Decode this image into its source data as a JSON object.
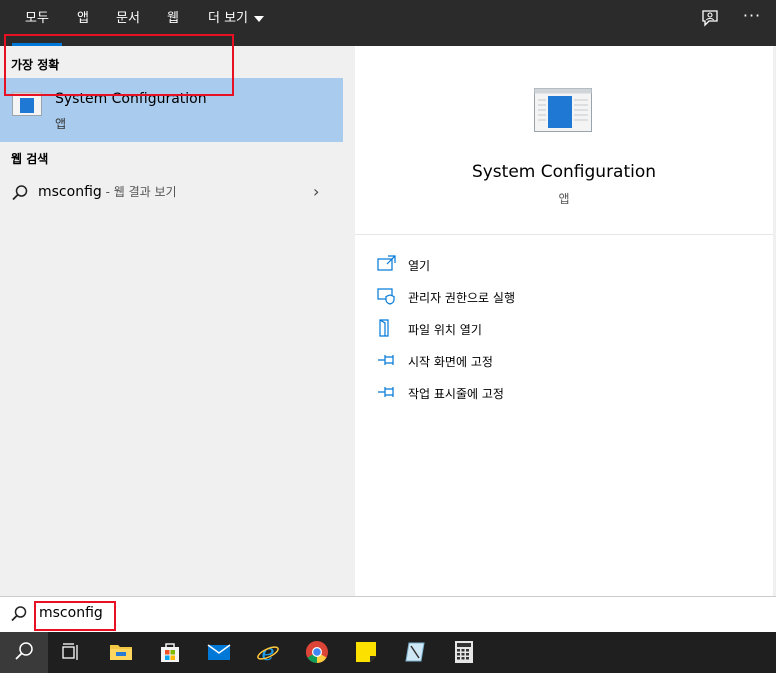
{
  "tabs": [
    {
      "label": "모두",
      "active": true
    },
    {
      "label": "앱"
    },
    {
      "label": "문서"
    },
    {
      "label": "웹"
    },
    {
      "label": "더 보기"
    }
  ],
  "topbar_icons": [
    "feedback-icon",
    "more-options-icon"
  ],
  "left": {
    "best_match_label": "가장 정확",
    "best_match": {
      "title": "System Configuration",
      "subtitle": "앱",
      "icon": "system-configuration-icon"
    },
    "web_search_label": "웹 검색",
    "web_search": {
      "query": "msconfig",
      "hint": " - 웹 결과 보기",
      "icon": "search-icon"
    }
  },
  "right": {
    "title": "System Configuration",
    "type": "앱",
    "actions": [
      {
        "label": "열기",
        "icon": "open-icon"
      },
      {
        "label": "관리자 권한으로 실행",
        "icon": "shield-admin-icon"
      },
      {
        "label": "파일 위치 열기",
        "icon": "file-location-icon"
      },
      {
        "label": "시작 화면에 고정",
        "icon": "pin-icon"
      },
      {
        "label": "작업 표시줄에 고정",
        "icon": "pin-icon"
      }
    ]
  },
  "search": {
    "value": "msconfig",
    "icon": "search-icon"
  },
  "taskbar": [
    "search-icon",
    "task-view-icon",
    "file-explorer-icon",
    "microsoft-store-icon",
    "mail-icon",
    "internet-explorer-icon",
    "chrome-icon",
    "sticky-notes-icon",
    "snipping-tool-icon",
    "calculator-icon"
  ],
  "colors": {
    "accent": "#0078d7",
    "selection": "#a8cbee",
    "highlight_box": "#e81123",
    "topbar": "#2b2b2b",
    "taskbar": "#1f1f1f"
  }
}
